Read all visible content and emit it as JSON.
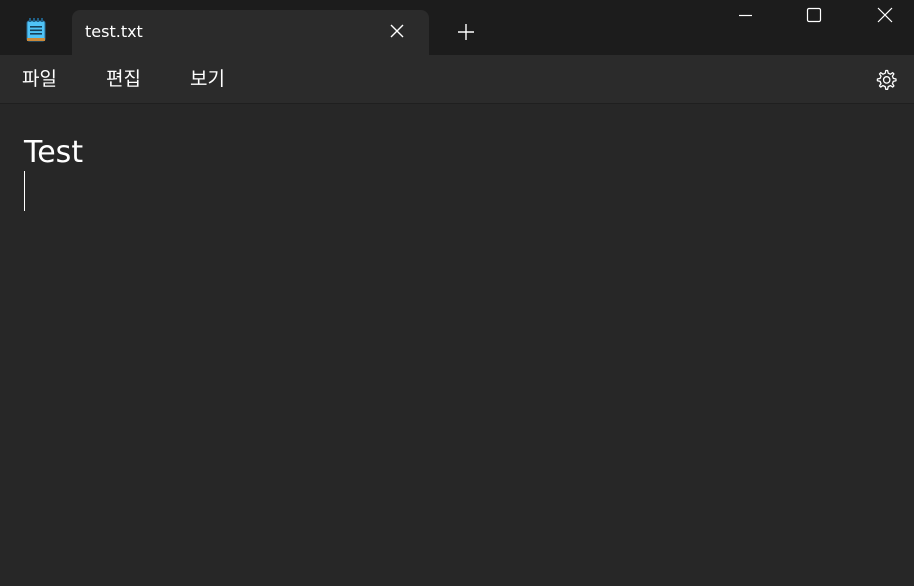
{
  "window": {
    "app_icon": "notepad-icon"
  },
  "tabs": [
    {
      "title": "test.txt",
      "close_icon": "close-icon"
    }
  ],
  "new_tab_icon": "plus-icon",
  "caption_buttons": {
    "minimize_icon": "minimize-icon",
    "maximize_icon": "maximize-icon",
    "close_icon": "close-icon"
  },
  "menu": {
    "file": "파일",
    "edit": "편집",
    "view": "보기",
    "settings_icon": "gear-icon"
  },
  "editor": {
    "content": "Test"
  },
  "colors": {
    "titlebar_bg": "#1c1c1c",
    "tab_bg": "#2b2b2b",
    "editor_bg": "#272727",
    "text": "#ffffff",
    "app_icon_blue": "#4fc3f7"
  }
}
